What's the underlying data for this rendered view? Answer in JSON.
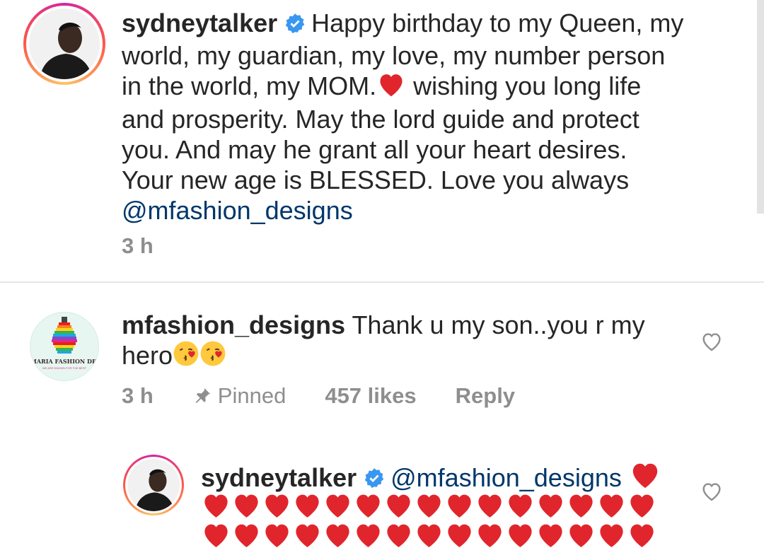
{
  "comments": [
    {
      "username": "sydneytalker",
      "verified": true,
      "text_parts": [
        "Happy birthday to my Queen, my",
        "world, my guardian, my love, my number person",
        "in the world, my MOM.",
        " wishing you long life",
        "and prosperity. May the lord guide and protect",
        "you. And may he grant all your heart desires.",
        "Your new age is BLESSED. Love you always"
      ],
      "mention": "@mfashion_designs",
      "time": "3 h"
    },
    {
      "username": "mfashion_designs",
      "text_line1": "Thank u my son..you r my",
      "text_line2": "hero",
      "avatar_logo_text": "MARIA FASHION DESIGNS",
      "avatar_logo_sub": "WE ARE KNOWN FOR THE BEST",
      "time": "3 h",
      "pinned_label": "Pinned",
      "likes": "457 likes",
      "reply_label": "Reply"
    },
    {
      "username": "sydneytalker",
      "verified": true,
      "mention": "@mfashion_designs",
      "hearts_row_count": 15
    }
  ],
  "colors": {
    "mention": "#00376b",
    "meta": "#8e8e8e",
    "heart": "#e0262c",
    "verified": "#3897f0"
  }
}
